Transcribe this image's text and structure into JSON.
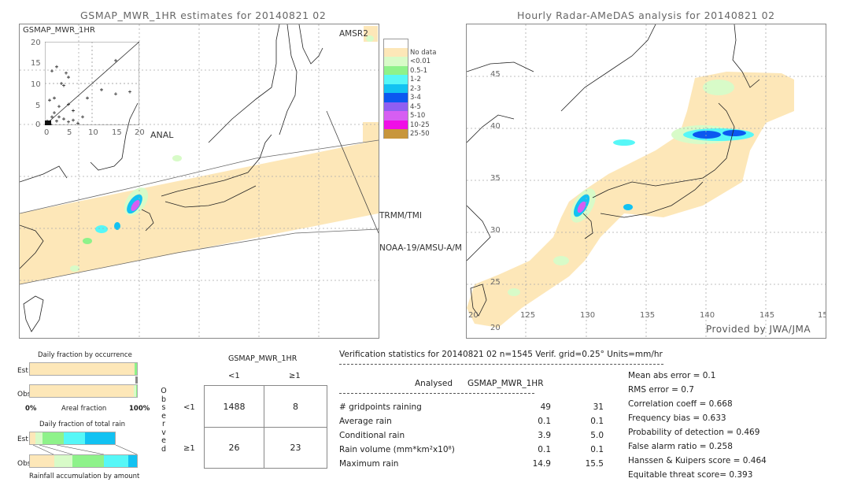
{
  "left_panel": {
    "title": "GSMAP_MWR_1HR estimates for 20140821 02",
    "inset": {
      "title": "GSMAP_MWR_1HR",
      "y_ticks": [
        "20",
        "15",
        "10",
        "5",
        "0"
      ],
      "x_ticks": [
        "0",
        "5",
        "10",
        "15",
        "20"
      ],
      "xlabel": "ANAL"
    },
    "sensor_labels": [
      "AMSR2",
      "TRMM/TMI",
      "NOAA-19/AMSU-A/M"
    ]
  },
  "legend": {
    "items": [
      {
        "label": "",
        "color": "#ffffff"
      },
      {
        "label": "No data",
        "color": "#fde7b8"
      },
      {
        "label": "<0.01",
        "color": "#d8fbc8"
      },
      {
        "label": "0.5-1",
        "color": "#8ef28a"
      },
      {
        "label": "1-2",
        "color": "#56f7f7"
      },
      {
        "label": "2-3",
        "color": "#12c2f2"
      },
      {
        "label": "3-4",
        "color": "#0b58f0"
      },
      {
        "label": "4-5",
        "color": "#8f5ef2"
      },
      {
        "label": "5-10",
        "color": "#d65ef2"
      },
      {
        "label": "10-25",
        "color": "#f00ee6"
      },
      {
        "label": "25-50",
        "color": "#c8963c"
      }
    ]
  },
  "right_panel": {
    "title": "Hourly Radar-AMeDAS analysis for 20140821 02",
    "lat_ticks": [
      "45",
      "40",
      "35",
      "30",
      "25",
      "20"
    ],
    "lon_ticks": [
      "20",
      "125",
      "130",
      "135",
      "140",
      "145",
      "15"
    ],
    "credit": "Provided by JWA/JMA"
  },
  "chart_data": [
    {
      "type": "scatter",
      "title": "GSMAP_MWR_1HR",
      "xlabel": "ANAL",
      "ylabel": "GSMAP_MWR_1HR",
      "xlim": [
        0,
        20
      ],
      "ylim": [
        0,
        20
      ],
      "x_ticks": [
        0,
        5,
        10,
        15,
        20
      ],
      "y_ticks": [
        0,
        5,
        10,
        15,
        20
      ],
      "points": [
        [
          1.5,
          13
        ],
        [
          2.5,
          14
        ],
        [
          4.5,
          12.5
        ],
        [
          5,
          11.5
        ],
        [
          3.5,
          10
        ],
        [
          4,
          9.5
        ],
        [
          1,
          6
        ],
        [
          2,
          6.5
        ],
        [
          3,
          4.5
        ],
        [
          5,
          5
        ],
        [
          6,
          3.5
        ],
        [
          2,
          3
        ],
        [
          3,
          2
        ],
        [
          4,
          1.5
        ],
        [
          1.5,
          2
        ],
        [
          2.5,
          1
        ],
        [
          5,
          0.8
        ],
        [
          6,
          1.2
        ],
        [
          7,
          0.5
        ],
        [
          8,
          2
        ],
        [
          9,
          6.5
        ],
        [
          12,
          8.5
        ],
        [
          15,
          7.5
        ],
        [
          18,
          8
        ],
        [
          15,
          15.5
        ],
        [
          0.3,
          0.3
        ],
        [
          0.8,
          0.5
        ],
        [
          1.2,
          0.2
        ],
        [
          0.5,
          1
        ]
      ]
    },
    {
      "type": "bar",
      "title": "Daily fraction by occurrence",
      "xlabel": "Areal fraction",
      "x_tick_labels": [
        "0%",
        "100%"
      ],
      "categories": [
        "Est",
        "Obs"
      ],
      "series": [
        {
          "name": "Est",
          "segments": [
            {
              "color": "#fde7b8",
              "fraction": 0.98
            },
            {
              "color": "#8ef28a",
              "fraction": 0.02
            }
          ]
        },
        {
          "name": "Obs",
          "segments": [
            {
              "color": "#fde7b8",
              "fraction": 0.97
            },
            {
              "color": "#d8fbc8",
              "fraction": 0.02
            },
            {
              "color": "#8ef28a",
              "fraction": 0.01
            }
          ]
        }
      ]
    },
    {
      "type": "bar",
      "title": "Daily fraction of total rain",
      "xlabel": "Rainfall accumulation by amount",
      "categories": [
        "Est",
        "Obs"
      ],
      "series": [
        {
          "name": "Est",
          "total_fraction": 0.8,
          "segments": [
            {
              "color": "#fde7b8",
              "fraction": 0.05
            },
            {
              "color": "#d8fbc8",
              "fraction": 0.07
            },
            {
              "color": "#8ef28a",
              "fraction": 0.2
            },
            {
              "color": "#56f7f7",
              "fraction": 0.2
            },
            {
              "color": "#12c2f2",
              "fraction": 0.28
            }
          ]
        },
        {
          "name": "Obs",
          "total_fraction": 1.0,
          "segments": [
            {
              "color": "#fde7b8",
              "fraction": 0.23
            },
            {
              "color": "#d8fbc8",
              "fraction": 0.17
            },
            {
              "color": "#8ef28a",
              "fraction": 0.29
            },
            {
              "color": "#56f7f7",
              "fraction": 0.23
            },
            {
              "color": "#12c2f2",
              "fraction": 0.08
            }
          ]
        }
      ]
    },
    {
      "type": "table",
      "title": "GSMAP_MWR_1HR",
      "col_headers": [
        "<1",
        "≥1"
      ],
      "row_headers": [
        "<1",
        "≥1"
      ],
      "row_axis_label": "Observed",
      "cells": [
        [
          "1488",
          "8"
        ],
        [
          "26",
          "23"
        ]
      ]
    }
  ],
  "histo": {
    "occurrence_title": "Daily fraction by occurrence",
    "est": "Est",
    "obs": "Obs",
    "x0": "0%",
    "x1": "100%",
    "xlabel": "Areal fraction",
    "rain_title": "Daily fraction of total rain",
    "rain_xlabel": "Rainfall accumulation by amount"
  },
  "contingency": {
    "title": "GSMAP_MWR_1HR",
    "col_lt": "<1",
    "col_ge": "≥1",
    "row_lt": "<1",
    "row_ge": "≥1",
    "row_axis": "Observed",
    "cells": [
      "1488",
      "8",
      "26",
      "23"
    ]
  },
  "stats": {
    "header": "Verification statistics for 20140821 02   n=1545   Verif. grid=0.25°   Units=mm/hr",
    "col_analysed": "Analysed",
    "col_gsmap": "GSMAP_MWR_1HR",
    "rows": [
      {
        "label": "# gridpoints raining",
        "analysed": "49",
        "gsmap": "31"
      },
      {
        "label": "Average rain",
        "analysed": "0.1",
        "gsmap": "0.1"
      },
      {
        "label": "Conditional rain",
        "analysed": "3.9",
        "gsmap": "5.0"
      },
      {
        "label": "Rain volume (mm*km²x10⁸)",
        "analysed": "0.1",
        "gsmap": "0.1"
      },
      {
        "label": "Maximum rain",
        "analysed": "14.9",
        "gsmap": "15.5"
      }
    ],
    "scores": [
      "Mean abs error = 0.1",
      "RMS error = 0.7",
      "Correlation coeff = 0.668",
      "Frequency bias = 0.633",
      "Probability of detection = 0.469",
      "False alarm ratio = 0.258",
      "Hanssen & Kuipers score = 0.464",
      "Equitable threat score= 0.393"
    ]
  }
}
